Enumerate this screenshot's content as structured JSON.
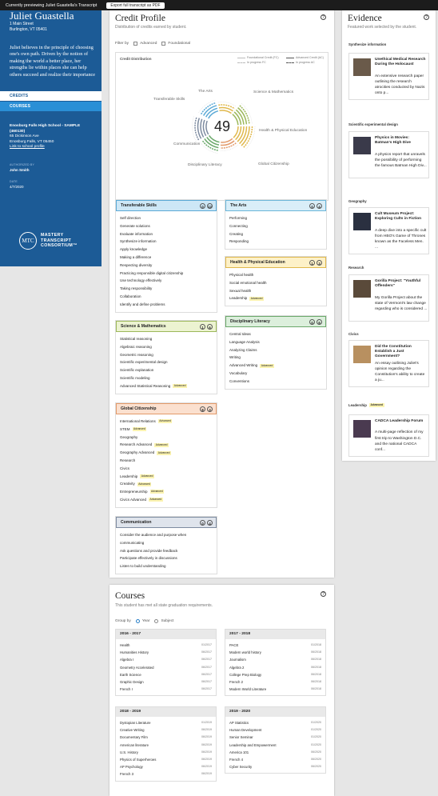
{
  "topbar": {
    "preview_text": "Currently previewing Juliet Guastella's Transcript",
    "export_label": "Export full transcript as PDF"
  },
  "student": {
    "name": "Juliet Guastella",
    "address_line1": "1 Main Street",
    "address_line2": "Burlington, VT 05401",
    "bio": "Juliet believes in the principle of choosing one's own path. Driven by the notion of making the world a better place, her strengths lie within places she can help others succeed and realize their importance"
  },
  "nav": {
    "credits": "CREDITS",
    "courses": "COURSES"
  },
  "school": {
    "name": "Enosburg Falls High School - SAMPLE (460130)",
    "street": "65 Dickinson Ave",
    "city": "Enosburg Falls, VT 05450",
    "link": "Link to school profile",
    "authorized_label": "AUTHORIZED BY",
    "authorized_by": "John Smith",
    "date_label": "DATE",
    "date": "4/7/2020"
  },
  "logo": {
    "mark": "MTC",
    "line1": "MASTERY",
    "line2": "TRANSCRIPT",
    "line3": "CONSORTIUM™"
  },
  "credit_profile": {
    "title": "Credit Profile",
    "subtitle": "Distribution of credits earned by student.",
    "help": "?",
    "filter_label": "Filter by",
    "filter_advanced": "Advanced",
    "filter_foundational": "Foundational",
    "distribution_title": "Credit Distribution",
    "legend": {
      "foundational": "Foundational Credit (FC)",
      "advanced": "Advanced Credit (AC)",
      "in_progress_fc": "In progress FC",
      "in_progress_ac": "In progress AC"
    },
    "total": "49",
    "wheel_labels": {
      "the_arts": "The Arts",
      "science_math": "Science & Mathematics",
      "transferable": "Transferable Skills",
      "health": "Health & Physical Education",
      "communication": "Communication",
      "global": "Global Citizenship",
      "disciplinary": "Disciplinary Literacy"
    }
  },
  "categories": {
    "transferable": {
      "title": "Transferable Skills",
      "a": "0",
      "b": "12",
      "items": [
        "Self direction",
        "Generate solutions",
        "Evaluate information",
        "Synthesize information",
        "Apply knowledge",
        "Making a difference",
        "Respecting diversity",
        "Practicing responsible digital citizenship",
        "Use technology effectively",
        "Taking responsibility",
        "Collaboration",
        "Identify and define problems"
      ]
    },
    "arts": {
      "title": "The Arts",
      "a": "0",
      "b": "4",
      "items": [
        "Performing",
        "Connecting",
        "Creating",
        "Responding"
      ]
    },
    "health": {
      "title": "Health & Physical Education",
      "a": "1",
      "b": "3",
      "items": [
        "Physical health",
        "Social emotional health",
        "Sexual health",
        "Leadership"
      ],
      "adv": [
        false,
        false,
        false,
        true
      ]
    },
    "disciplinary": {
      "title": "Disciplinary Literacy",
      "a": "0",
      "b": "6",
      "items": [
        "Central Ideas",
        "Language Analysis",
        "Analyzing Claims",
        "Writing",
        "Advanced Writing",
        "Vocabulary",
        "Conventions"
      ],
      "adv": [
        false,
        false,
        false,
        false,
        true,
        false,
        false
      ]
    },
    "science": {
      "title": "Science & Mathematics",
      "a": "1",
      "b": "6",
      "items": [
        "Statistical reasoning",
        "Algebraic reasoning",
        "Geometric reasoning",
        "Scientific experimental design",
        "Scientific explanation",
        "Scientific modeling",
        "Advanced Statistical Reasoning"
      ],
      "adv": [
        false,
        false,
        false,
        false,
        false,
        false,
        true
      ]
    },
    "global": {
      "title": "Global Citizenship",
      "a": "8",
      "b": "3",
      "items": [
        "International Relations",
        "STEM",
        "Geography",
        "Research Advanced",
        "Geography Advanced",
        "Research",
        "Civics",
        "Leadership",
        "Creativity",
        "Entrepreneurship",
        "Civics Advanced"
      ],
      "adv": [
        true,
        true,
        false,
        true,
        true,
        false,
        false,
        true,
        true,
        true,
        true
      ]
    },
    "communication": {
      "title": "Communication",
      "a": "0",
      "b": "4",
      "items": [
        "Consider the audience and purpose when",
        "communicating",
        "Ask questions and provide feedback",
        "Participate effectively in discussions",
        "Listen to build understanding"
      ]
    }
  },
  "advanced_tag": "Advanced",
  "evidence": {
    "title": "Evidence",
    "subtitle": "Featured work selected by the student.",
    "help": "?",
    "items": [
      {
        "section": "Synthesize information",
        "title": "Unethical Medical Research During the Holocaust",
        "desc": "An extensive research paper outlining the research atrocities conducted by Nazis onto p..."
      },
      {
        "section": "Scientific experimental design",
        "title": "Physics in Movies: Batman's High Dive",
        "desc": "A physics report that unravels the possibility of performing the famous Batman High Div..."
      },
      {
        "section": "Geography",
        "title": "Cult Museum Project: Exploring Cults in Fiction",
        "desc": "A deep dive into a specific cult from HBO's Game of Thrones known as the Faceless Men. ..."
      },
      {
        "section": "Research",
        "title": "Gorilla Project: \"Youthful Offenders\"",
        "desc": "My Gorilla Project about the state of Vermont's law change regarding who is considered ..."
      },
      {
        "section": "Civics",
        "title": "Did the Constitution Establish a Just Government?",
        "desc": "An essay outlining Juliet's opinion regarding the Constitution's ability to create a ju..."
      },
      {
        "section": "Leadership",
        "section_badge": "Advanced",
        "title": "CADCA Leadership Forum",
        "desc": "A multi-page reflection of my first trip to Washington D.C. and the national CADCA conf..."
      }
    ]
  },
  "courses": {
    "title": "Courses",
    "subtitle": "This student has met all state graduation requirements.",
    "help": "?",
    "group_label": "Group by",
    "group_year": "Year",
    "group_subject": "Subject",
    "years": [
      {
        "label": "2016 - 2017",
        "rows": [
          [
            "Health",
            "01/2017"
          ],
          [
            "Humanities History",
            "06/2017"
          ],
          [
            "Algebra I",
            "06/2017"
          ],
          [
            "Geometry Accelerated",
            "06/2017"
          ],
          [
            "Earth Science",
            "06/2017"
          ],
          [
            "Graphic Design",
            "06/2017"
          ],
          [
            "French I",
            "06/2017"
          ]
        ]
      },
      {
        "label": "2017 - 2018",
        "rows": [
          [
            "PACE",
            "01/2018"
          ],
          [
            "Modern world history",
            "06/2018"
          ],
          [
            "Journalism",
            "06/2018"
          ],
          [
            "Algebra 2",
            "06/2018"
          ],
          [
            "College Prep Biology",
            "06/2018"
          ],
          [
            "French 2",
            "06/2018"
          ],
          [
            "Modern World Literature",
            "06/2018"
          ]
        ]
      },
      {
        "label": "2018 - 2019",
        "rows": [
          [
            "Dystopian Literature",
            "01/2019"
          ],
          [
            "Creative Writing",
            "06/2019"
          ],
          [
            "Documentary Film",
            "06/2019"
          ],
          [
            "American literature",
            "06/2019"
          ],
          [
            "U.S. History",
            "06/2019"
          ],
          [
            "Physics of Superheroes",
            "06/2019"
          ],
          [
            "AP Psychology",
            "06/2019"
          ],
          [
            "French 3",
            "06/2019"
          ]
        ]
      },
      {
        "label": "2019 - 2020",
        "rows": [
          [
            "AP Statistics",
            "01/2020"
          ],
          [
            "Human Development",
            "01/2020"
          ],
          [
            "Senior Seminar",
            "01/2020"
          ],
          [
            "Leadership and Empowerment",
            "01/2020"
          ],
          [
            "America 101",
            "06/2020"
          ],
          [
            "French 4",
            "06/2020"
          ],
          [
            "Cyber Security",
            "06/2020"
          ]
        ]
      }
    ]
  },
  "colors": {
    "brand_blue": "#1c5b96",
    "active_nav": "#2a8fd6",
    "transferable": "#a9d4ec",
    "arts": "#cfe9f6",
    "health": "#fbeec0",
    "disciplinary": "#d6ecd6",
    "science": "#e6f0c8",
    "global": "#f8d9c4",
    "communication": "#d7dde6",
    "advanced_tag": "#fbf3b0"
  }
}
